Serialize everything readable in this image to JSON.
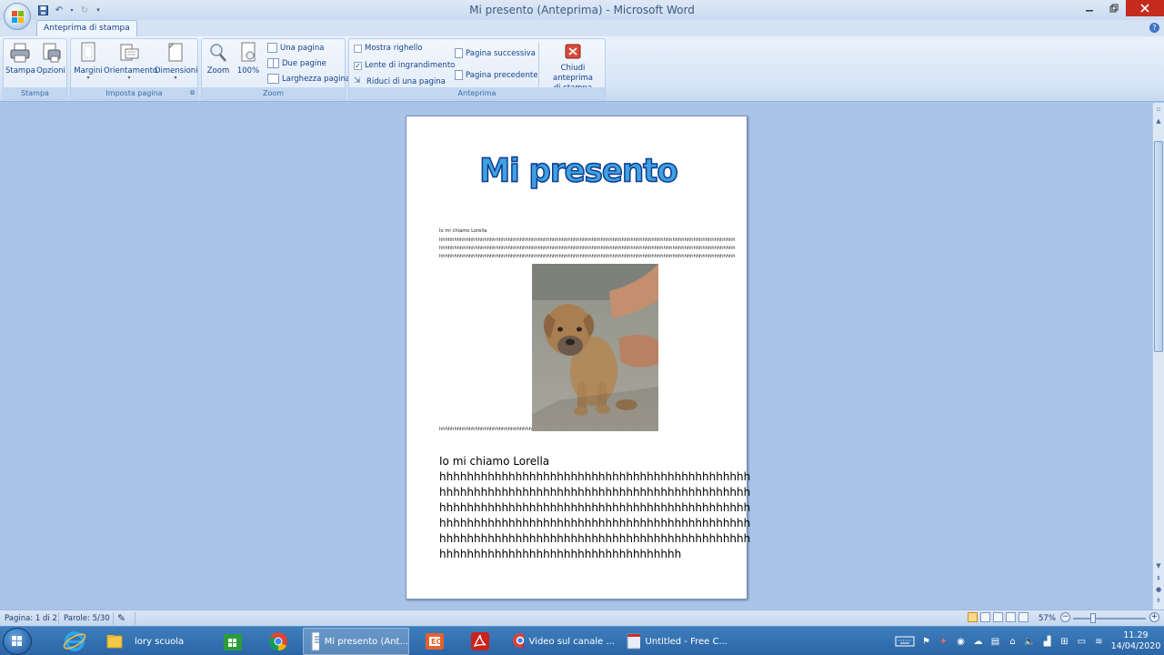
{
  "window": {
    "title": "Mi presento (Anteprima) - Microsoft Word"
  },
  "quick_access": {
    "save": "save-icon",
    "undo": "undo-icon",
    "redo": "redo-icon"
  },
  "tabs": [
    {
      "label": "Anteprima di stampa"
    }
  ],
  "ribbon": {
    "groups": {
      "stampa": {
        "label": "Stampa",
        "stampa": "Stampa",
        "opzioni": "Opzioni"
      },
      "imposta": {
        "label": "Imposta pagina",
        "margini": "Margini",
        "orientamento": "Orientamento",
        "dimensioni": "Dimensioni"
      },
      "zoom": {
        "label": "Zoom",
        "zoom": "Zoom",
        "cento": "100%",
        "una_pagina": "Una pagina",
        "due_pagine": "Due pagine",
        "larghezza": "Larghezza pagina"
      },
      "anteprima": {
        "label": "Anteprima",
        "mostra_righello": "Mostra righello",
        "lente": "Lente di ingrandimento",
        "riduci": "Riduci di una pagina",
        "successiva": "Pagina successiva",
        "precedente": "Pagina precedente",
        "chiudi_1": "Chiudi anteprima",
        "chiudi_2": "di stampa"
      },
      "checks": {
        "mostra_righello": false,
        "lente": true
      }
    }
  },
  "document": {
    "wordart": "Mi presento",
    "small_name": "Io mi chiamo  Lorella",
    "small_lines": [
      "hhhhhhhhhhhhhhhhhhhhhhhhhhhhhhhhhhhhhhhhhhhhhhhhhhhhhhhhhhhhhhhhhhhhhhhhhhhhhhhhhhhhhhhhhhhhhhhhhhh",
      "hhhhhhhhhhhhhhhhhhhhhhhhhhhhhhhhhhhhhhhhhhhhhhhhhhhhhhhhhhhhhhhhhhhhhhhhhhhhhhhhhhhhhhhhhhhhhhhhhhh",
      "hhhhhhhhhhhhhhhhhhhhhhhhhhhhhhhhhhhhhhhhhhhhhhhhhhhhhhhhhhhhhhhhhhhhhhhhhhhhhhhhhhhhhhhhhhhhhhhhhhh"
    ],
    "small_tail": "hhhhhhhhhhhhhhhhhhhhhhhhhhhhhhh",
    "big_name": "Io mi chiamo Lorella",
    "big_lines": [
      "hhhhhhhhhhhhhhhhhhhhhhhhhhhhhhhhhhhhhhhhhhhhh",
      "hhhhhhhhhhhhhhhhhhhhhhhhhhhhhhhhhhhhhhhhhhhhh",
      "hhhhhhhhhhhhhhhhhhhhhhhhhhhhhhhhhhhhhhhhhhhhh",
      "hhhhhhhhhhhhhhhhhhhhhhhhhhhhhhhhhhhhhhhhhhhhh",
      "hhhhhhhhhhhhhhhhhhhhhhhhhhhhhhhhhhhhhhhhhhhhh",
      "hhhhhhhhhhhhhhhhhhhhhhhhhhhhhhhhhhh"
    ]
  },
  "status": {
    "page": "Pagina: 1 di 2",
    "words": "Parole: 5/30",
    "zoom": "57%"
  },
  "taskbar": {
    "apps": [
      {
        "label": "lory scuola"
      },
      {
        "label": "Mi presento (Ant..."
      },
      {
        "label": "Video sul canale ..."
      },
      {
        "label": "Untitled - Free C..."
      }
    ],
    "time": "11.29",
    "date": "14/04/2020"
  },
  "colors": {
    "accent": "#15428b",
    "wordart_fill": "#3fa1e0",
    "wordart_outline": "#0d3d91",
    "taskbar": "#2b65a6",
    "close": "#c42b1c"
  }
}
